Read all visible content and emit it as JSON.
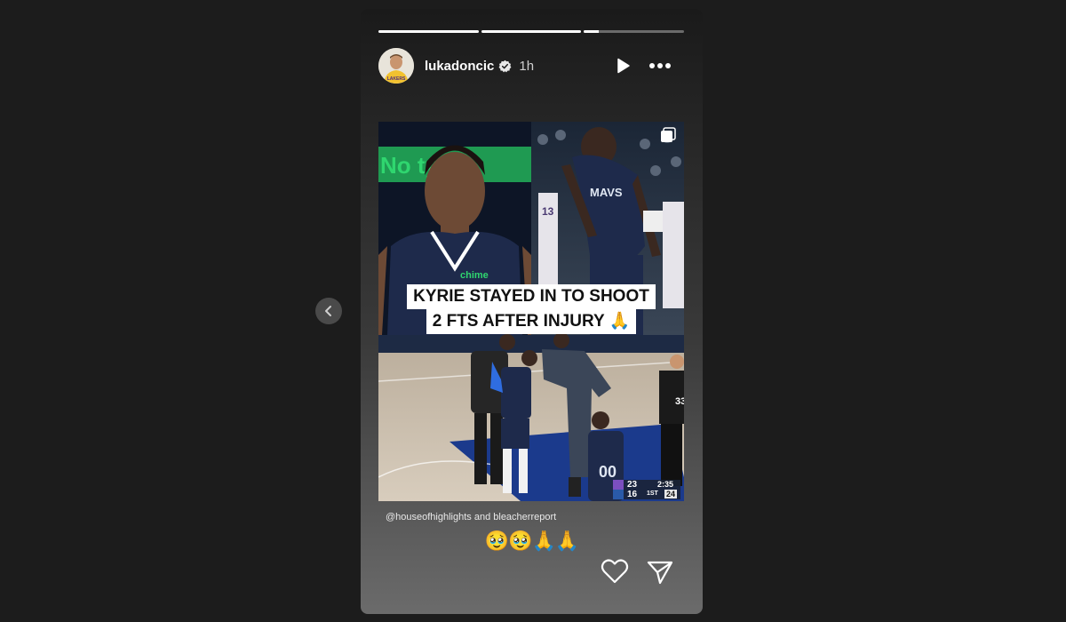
{
  "story": {
    "progress": [
      1,
      1,
      0.15
    ],
    "user": {
      "username": "lukadoncic",
      "verified": true,
      "time_ago": "1h"
    },
    "media": {
      "caption_line1": "KYRIE STAYED IN TO SHOOT",
      "caption_line2": "2 FTS AFTER INJURY 🙏",
      "jersey_text": "chime",
      "banner_text": "No ty fo",
      "scoreboard": {
        "home": "23",
        "away": "16",
        "clock": "2:35",
        "period": "1ST",
        "shot_clock": "24"
      }
    },
    "credit": "@houseofhighlights and bleacherreport",
    "emojis": "🥹🥹🙏🙏",
    "icons": {
      "play": "play-icon",
      "more": "more-icon",
      "like": "heart-icon",
      "share": "send-icon",
      "prev": "chevron-left-icon",
      "verified": "verified-badge-icon"
    }
  }
}
